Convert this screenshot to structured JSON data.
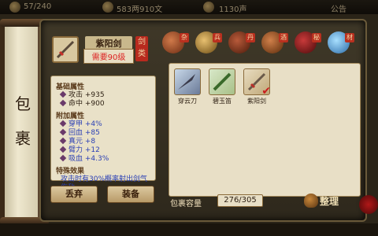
{
  "topbar": {
    "stat1": "57/240",
    "stat2": "583两910文",
    "stat3": "1130声",
    "announcement": "公告"
  },
  "scroll": {
    "title_char1": "包",
    "title_char2": "裹"
  },
  "item": {
    "name": "紫阳剑",
    "level_req": "需要90级",
    "type_label": "剑类"
  },
  "stats": {
    "base_header": "基础属性",
    "base": [
      {
        "label": "攻击",
        "value": "+935"
      },
      {
        "label": "命中",
        "value": "+900"
      }
    ],
    "bonus_header": "附加属性",
    "bonus": [
      {
        "label": "穿甲",
        "value": "+4%"
      },
      {
        "label": "回血",
        "value": "+85"
      },
      {
        "label": "真元",
        "value": "+8"
      },
      {
        "label": "臂力",
        "value": "+12"
      },
      {
        "label": "吸血",
        "value": "+4.3%"
      }
    ],
    "effect_header": "特殊效果",
    "effect_text": "攻击时有30%概率射出剑气伤敌"
  },
  "buttons": {
    "discard": "丢弃",
    "equip": "装备",
    "sort": "整理"
  },
  "tabs": [
    {
      "label": "杂",
      "icon": "pot-icon",
      "color": "#b0502a"
    },
    {
      "label": "兵",
      "icon": "weapon-icon",
      "color": "#c79a3a"
    },
    {
      "label": "丹",
      "icon": "pill-icon",
      "color": "#8a3a2a"
    },
    {
      "label": "酒",
      "icon": "wine-jar-icon",
      "color": "#a8582a"
    },
    {
      "label": "秘",
      "icon": "book-icon",
      "color": "#9a2a2a"
    },
    {
      "label": "材",
      "icon": "crystal-icon",
      "color": "#3a9ad8"
    }
  ],
  "grid_items": [
    {
      "name": "穿云刀",
      "icon": "blade-icon",
      "color": "#7a8aa8"
    },
    {
      "name": "碧玉笛",
      "icon": "flute-icon",
      "color": "#6a9a4a"
    },
    {
      "name": "紫阳剑",
      "icon": "sword-icon",
      "color": "#c8b088",
      "selected": true
    }
  ],
  "capacity": {
    "label": "包裹容量",
    "value": "276/305"
  }
}
